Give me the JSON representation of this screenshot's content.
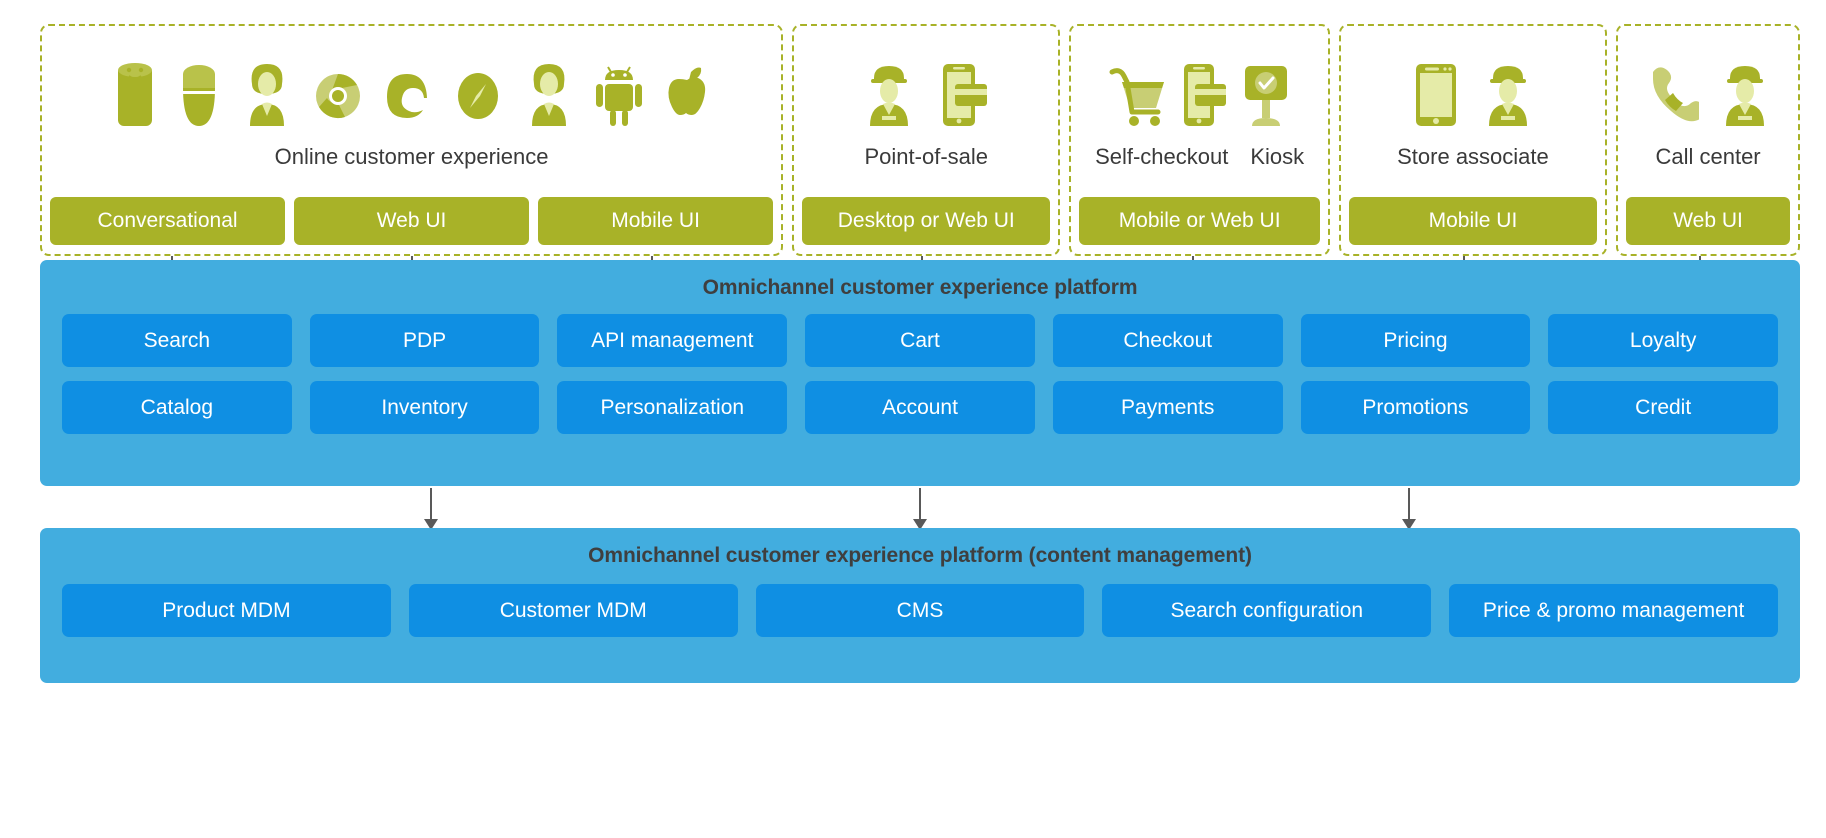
{
  "colors": {
    "channel_border": "#a8b228",
    "channel_chip": "#a8b228",
    "band": "#42addf",
    "tile": "#0f8fe3",
    "arrow": "#595959",
    "caption_text": "#3a3a3a",
    "band_title_text": "#3f3f3f"
  },
  "channels": [
    {
      "id": "online",
      "captions": [
        "Online customer experience"
      ],
      "icons": [
        "smart-speaker-icon",
        "smart-speaker-round-icon",
        "customer-avatar-icon",
        "chrome-browser-icon",
        "edge-browser-icon",
        "safari-browser-icon",
        "customer-avatar-icon",
        "android-icon",
        "apple-icon"
      ],
      "ui_chips": [
        "Conversational",
        "Web UI",
        "Mobile UI"
      ]
    },
    {
      "id": "point-of-sale",
      "captions": [
        "Point-of-sale"
      ],
      "icons": [
        "store-clerk-icon",
        "mobile-payment-icon"
      ],
      "ui_chips": [
        "Desktop or Web UI"
      ]
    },
    {
      "id": "self-checkout-kiosk",
      "captions": [
        "Self-checkout",
        "Kiosk"
      ],
      "icons": [
        "shopping-cart-icon",
        "mobile-payment-icon",
        "kiosk-screen-icon"
      ],
      "ui_chips": [
        "Mobile or Web UI"
      ]
    },
    {
      "id": "store-associate",
      "captions": [
        "Store associate"
      ],
      "icons": [
        "tablet-icon",
        "store-clerk-icon"
      ],
      "ui_chips": [
        "Mobile UI"
      ]
    },
    {
      "id": "call-center",
      "captions": [
        "Call center"
      ],
      "icons": [
        "telephone-handset-icon",
        "store-clerk-icon"
      ],
      "ui_chips": [
        "Web UI"
      ]
    }
  ],
  "platform": {
    "title": "Omnichannel customer experience platform",
    "row1": [
      "Search",
      "PDP",
      "API management",
      "Cart",
      "Checkout",
      "Pricing",
      "Loyalty"
    ],
    "row2": [
      "Catalog",
      "Inventory",
      "Personalization",
      "Account",
      "Payments",
      "Promotions",
      "Credit"
    ]
  },
  "content_management": {
    "title": "Omnichannel customer experience platform (content management)",
    "tiles": [
      "Product MDM",
      "Customer MDM",
      "CMS",
      "Search configuration",
      "Price & promo management"
    ]
  }
}
